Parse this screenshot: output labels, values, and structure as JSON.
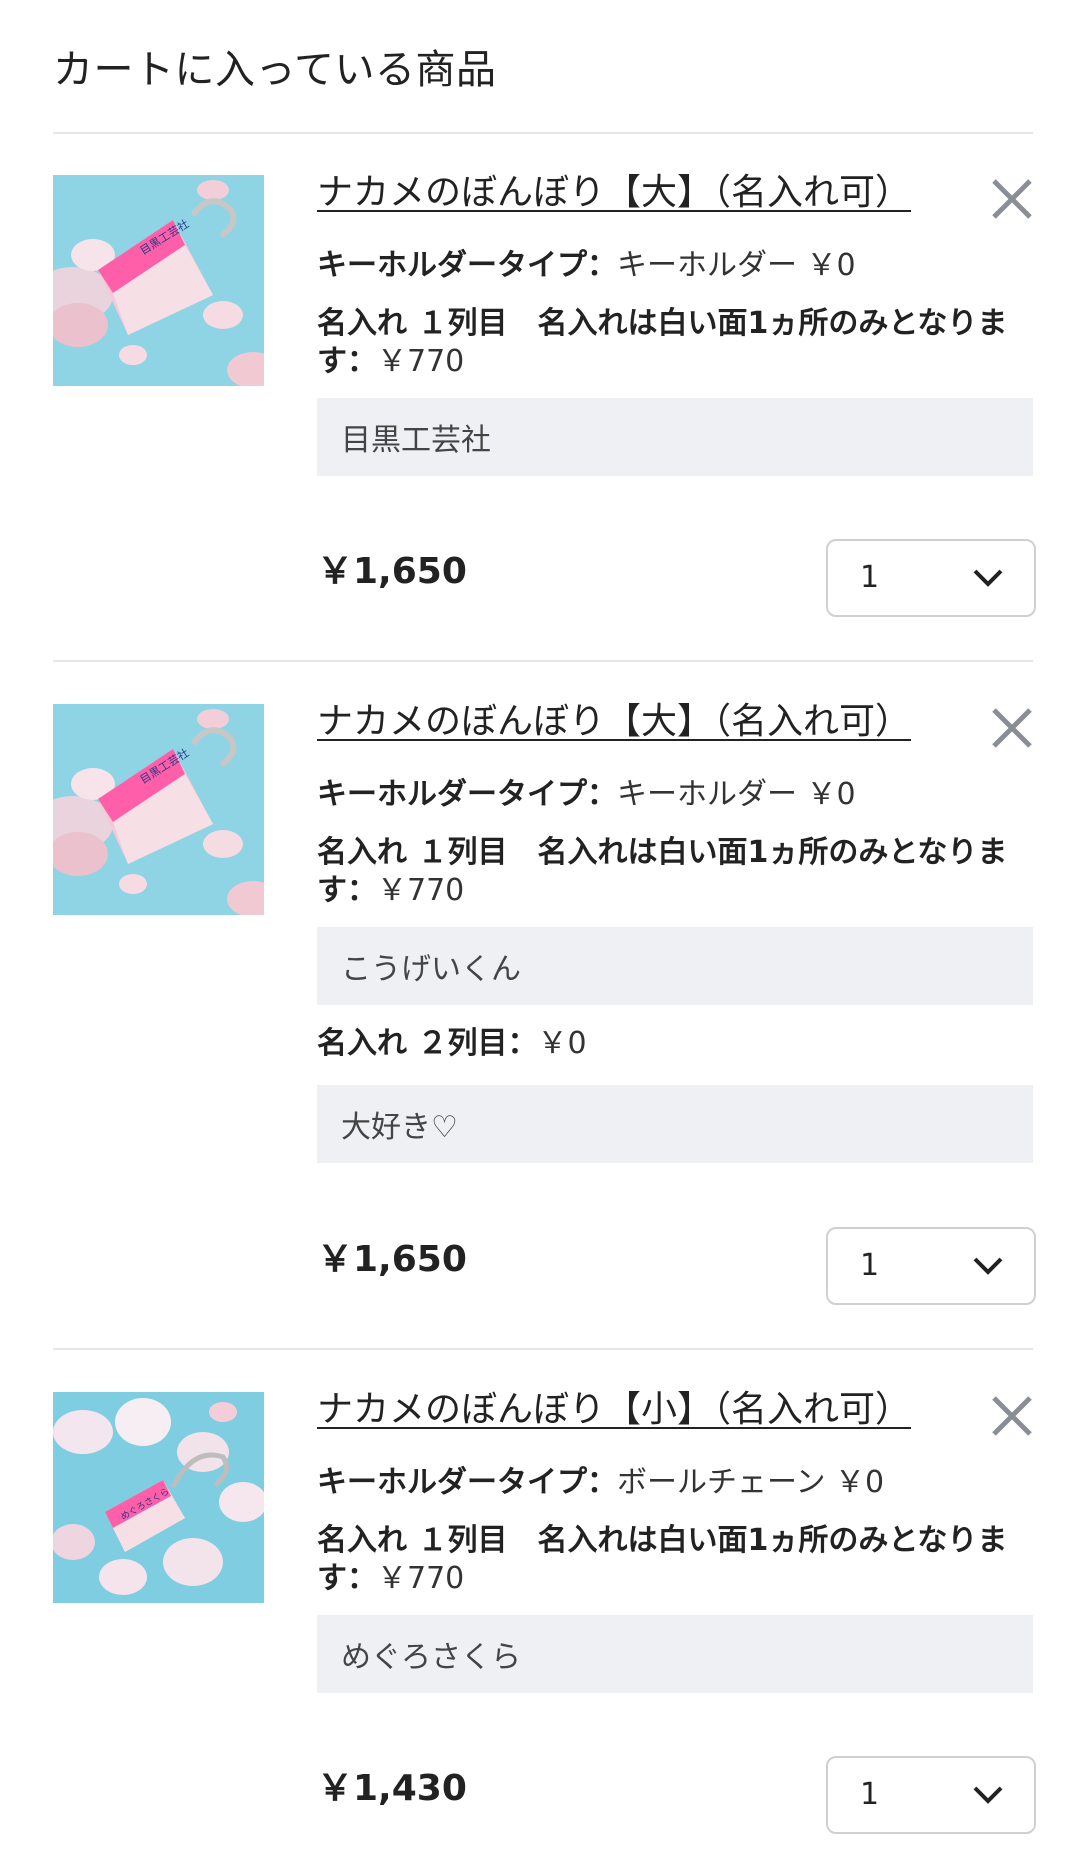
{
  "page": {
    "title": "カートに入っている商品"
  },
  "colors": {
    "text": "#222222",
    "input_bg": "#eef0f4",
    "divider": "#e6e6e6",
    "close_icon": "#8a8f96",
    "select_border": "#d0d0d0"
  },
  "items": [
    {
      "title": "ナカメのぼんぼり【大】（名入れ可）",
      "image_icon": "keychain-lantern-product-photo",
      "remove_icon": "close-icon",
      "options": [
        {
          "label": "キーホルダータイプ：",
          "value": "キーホルダー ￥0"
        },
        {
          "label": "名入れ １列目　名入れは白い面1ヵ所のみとなります：",
          "value": "￥770"
        }
      ],
      "inputs": [
        {
          "value": "目黒工芸社"
        }
      ],
      "price": "￥1,650",
      "quantity": "1"
    },
    {
      "title": "ナカメのぼんぼり【大】（名入れ可）",
      "image_icon": "keychain-lantern-product-photo",
      "remove_icon": "close-icon",
      "options": [
        {
          "label": "キーホルダータイプ：",
          "value": "キーホルダー ￥0"
        },
        {
          "label": "名入れ １列目　名入れは白い面1ヵ所のみとなります：",
          "value": "￥770"
        },
        {
          "label": "名入れ ２列目：",
          "value": "￥0"
        }
      ],
      "inputs": [
        {
          "value": "こうげいくん"
        },
        {
          "value": "大好き♡"
        }
      ],
      "price": "￥1,650",
      "quantity": "1"
    },
    {
      "title": "ナカメのぼんぼり【小】（名入れ可）",
      "image_icon": "ballchain-lantern-product-photo",
      "remove_icon": "close-icon",
      "options": [
        {
          "label": "キーホルダータイプ：",
          "value": "ボールチェーン ￥0"
        },
        {
          "label": "名入れ １列目　名入れは白い面1ヵ所のみとなります：",
          "value": "￥770"
        }
      ],
      "inputs": [
        {
          "value": "めぐろさくら"
        }
      ],
      "price": "￥1,430",
      "quantity": "1"
    }
  ]
}
